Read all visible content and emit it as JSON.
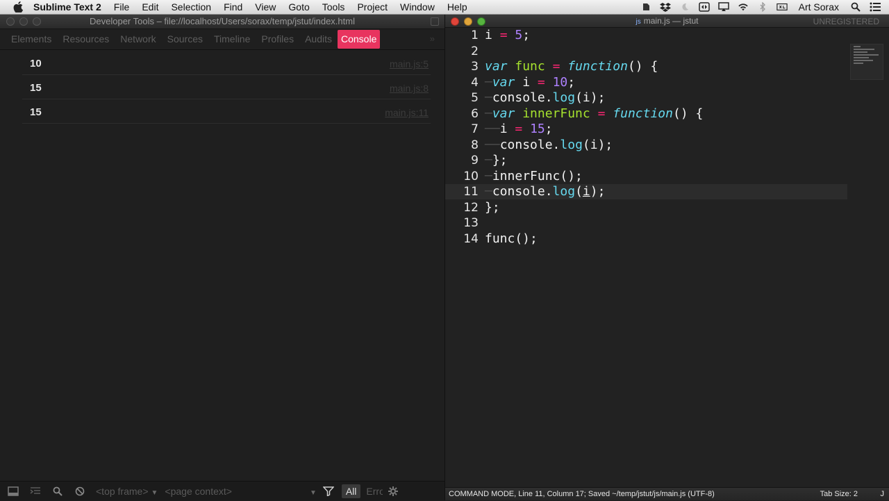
{
  "menubar": {
    "app_name": "Sublime Text 2",
    "items": [
      "File",
      "Edit",
      "Selection",
      "Find",
      "View",
      "Goto",
      "Tools",
      "Project",
      "Window",
      "Help"
    ],
    "user": "Art Sorax"
  },
  "devtools": {
    "title": "Developer Tools – file://localhost/Users/sorax/temp/jstut/index.html",
    "tabs": [
      "Elements",
      "Resources",
      "Network",
      "Sources",
      "Timeline",
      "Profiles",
      "Audits",
      "Console"
    ],
    "active_tab": "Console",
    "more": "»",
    "console_rows": [
      {
        "value": "10",
        "source": "main.js:5"
      },
      {
        "value": "15",
        "source": "main.js:8"
      },
      {
        "value": "15",
        "source": "main.js:11"
      }
    ],
    "bottom": {
      "frame_select": "<top frame>",
      "context_select": "<page context>",
      "filter_all": "All",
      "errors": "Errors"
    }
  },
  "editor": {
    "title_badge": "js",
    "title": "main.js — jstut",
    "unregistered": "UNREGISTERED",
    "current_line": 11,
    "line_numbers": [
      "1",
      "2",
      "3",
      "4",
      "5",
      "6",
      "7",
      "8",
      "9",
      "10",
      "11",
      "12",
      "13",
      "14"
    ],
    "status_left": "COMMAND MODE, Line 11, Column 17; Saved ~/temp/jstut/js/main.js (UTF-8)",
    "tab_size": "Tab Size: 2",
    "syntax": "J"
  }
}
